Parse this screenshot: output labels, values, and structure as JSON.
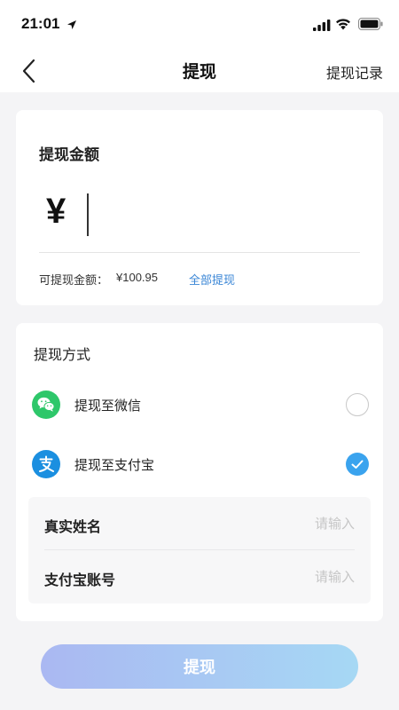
{
  "status_bar": {
    "time": "21:01"
  },
  "nav": {
    "title": "提现",
    "history_label": "提现记录"
  },
  "amount_card": {
    "title": "提现金额",
    "currency_symbol": "¥",
    "input_value": "",
    "available_label": "可提现金额：",
    "available_value": "¥100.95",
    "withdraw_all_label": "全部提现"
  },
  "method_card": {
    "title": "提现方式",
    "options": [
      {
        "label": "提现至微信",
        "selected": false,
        "icon": "wechat-icon",
        "color": "#2ec76a"
      },
      {
        "label": "提现至支付宝",
        "selected": true,
        "icon": "alipay-icon",
        "color": "#1b8fe0"
      }
    ],
    "fields": [
      {
        "label": "真实姓名",
        "placeholder": "请输入",
        "value": ""
      },
      {
        "label": "支付宝账号",
        "placeholder": "请输入",
        "value": ""
      }
    ]
  },
  "submit": {
    "label": "提现"
  },
  "colors": {
    "accent": "#3aa3ee",
    "link": "#3a86d6",
    "background": "#f4f4f6"
  }
}
